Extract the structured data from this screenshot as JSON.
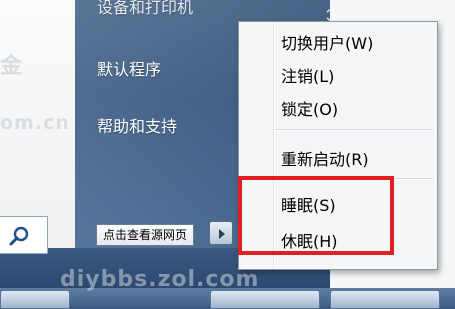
{
  "start_menu": {
    "top_partial_label": "设备和打印机",
    "items": [
      {
        "label": "默认程序"
      },
      {
        "label": "帮助和支持"
      }
    ],
    "tooltip": "点击查看源网页"
  },
  "context_menu": {
    "items": [
      {
        "label": "切换用户(W)"
      },
      {
        "label": "注销(L)"
      },
      {
        "label": "锁定(O)"
      },
      {
        "label": "重新启动(R)"
      },
      {
        "label": "睡眠(S)"
      },
      {
        "label": "休眠(H)"
      }
    ]
  },
  "watermark": {
    "left_top": "金",
    "left_mid": "om.cn",
    "bottom": "diybbs.zol.com"
  },
  "colors": {
    "highlight": "#e02020",
    "menu_bg": "#f5f6f7",
    "start_right_pane": "#4c6a8d"
  }
}
